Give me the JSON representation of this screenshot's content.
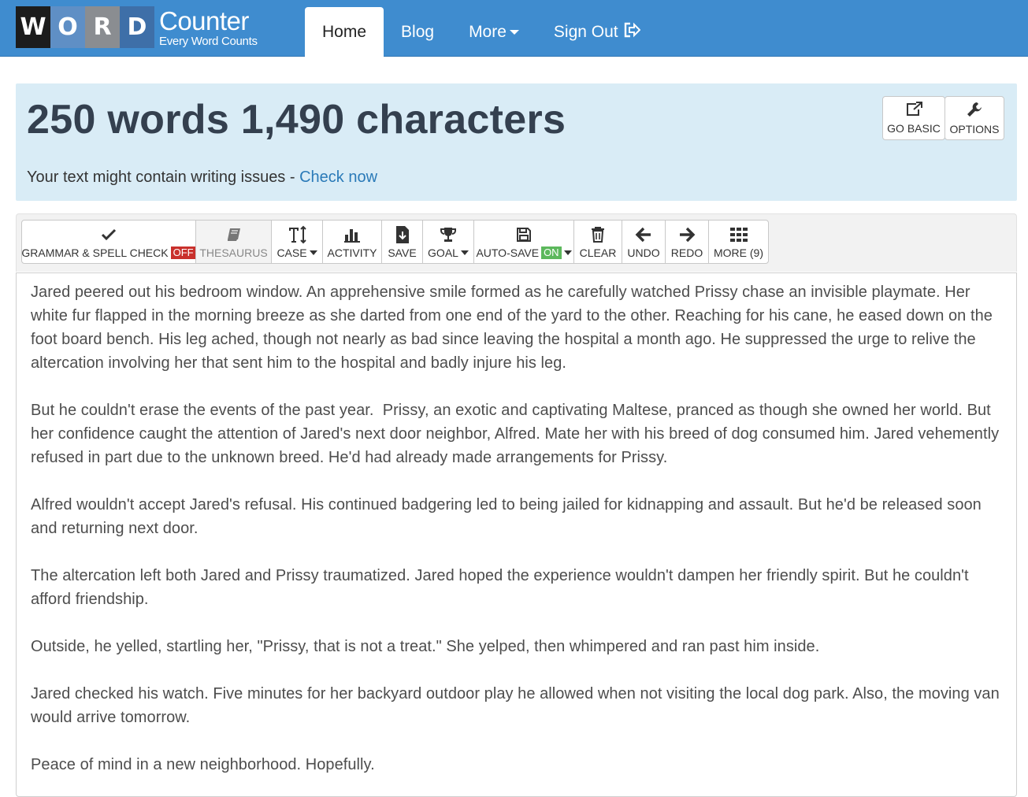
{
  "brand": {
    "tiles": [
      "W",
      "O",
      "R",
      "D"
    ],
    "title": "Counter",
    "tagline": "Every Word Counts"
  },
  "nav": {
    "home": "Home",
    "blog": "Blog",
    "more": "More",
    "signout": "Sign Out"
  },
  "stats": {
    "summary": "250 words 1,490 characters",
    "note": "Your text might contain writing issues - ",
    "note_link": "Check now"
  },
  "top_buttons": {
    "go_basic": "GO BASIC",
    "options": "OPTIONS"
  },
  "toolbar": {
    "grammar": "GRAMMAR & SPELL CHECK",
    "grammar_state": "OFF",
    "thesaurus": "THESAURUS",
    "case": "CASE",
    "activity": "ACTIVITY",
    "save": "SAVE",
    "goal": "GOAL",
    "autosave": "AUTO-SAVE",
    "autosave_state": "ON",
    "clear": "CLEAR",
    "undo": "UNDO",
    "redo": "REDO",
    "more": "MORE (9)"
  },
  "editor": {
    "paragraphs": [
      "Jared peered out his bedroom window. An apprehensive smile formed as he carefully watched Prissy chase an invisible playmate. Her white fur flapped in the morning breeze as she darted from one end of the yard to the other. Reaching for his cane, he eased down on the foot board bench. His leg ached, though not nearly as bad since leaving the hospital a month ago. He suppressed the urge to relive the altercation involving her that sent him to the hospital and badly injure his leg.",
      "But he couldn't erase the events of the past year.  Prissy, an exotic and captivating Maltese, pranced as though she owned her world. But her confidence caught the attention of Jared's next door neighbor, Alfred. Mate her with his breed of dog consumed him. Jared vehemently refused in part due to the unknown breed. He'd had already made arrangements for Prissy.",
      "Alfred wouldn't accept Jared's refusal. His continued badgering led to being jailed for kidnapping and assault. But he'd be released soon and returning next door.",
      "The altercation left both Jared and Prissy traumatized. Jared hoped the experience wouldn't dampen her friendly spirit. But he couldn't afford friendship.",
      "Outside, he yelled, startling her, \"Prissy, that is not a treat.\" She yelped, then whimpered and ran past him inside.",
      "Jared checked his watch. Five minutes for her backyard outdoor play he allowed when not visiting the local dog park. Also, the moving van would arrive tomorrow.",
      "Peace of mind in a new neighborhood. Hopefully."
    ]
  }
}
